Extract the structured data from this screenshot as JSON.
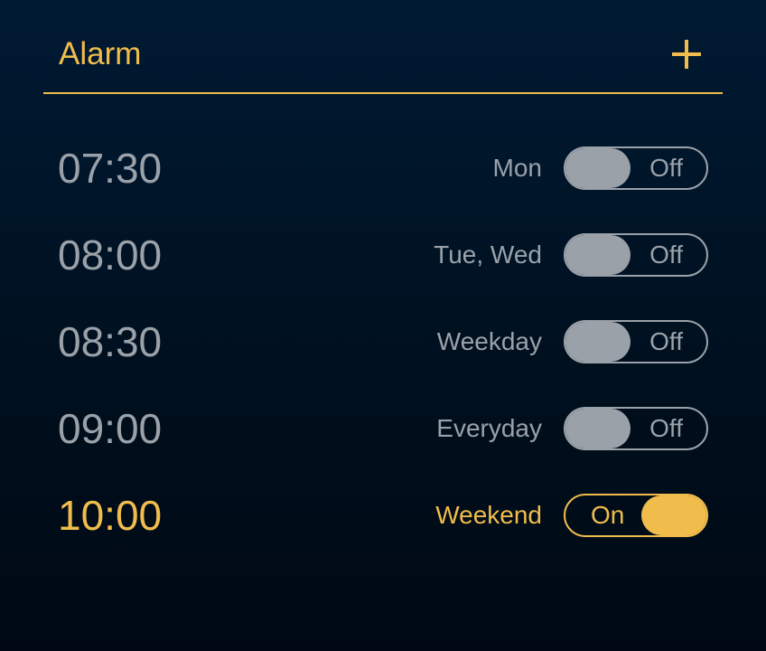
{
  "header": {
    "title": "Alarm",
    "add_icon": "plus-icon"
  },
  "colors": {
    "accent": "#f0bc4c",
    "inactive": "#9aa1a9",
    "background_top": "#001a33",
    "background_bottom": "#000913"
  },
  "alarms": [
    {
      "time": "07:30",
      "days": "Mon",
      "toggle_label": "Off",
      "enabled": false
    },
    {
      "time": "08:00",
      "days": "Tue, Wed",
      "toggle_label": "Off",
      "enabled": false
    },
    {
      "time": "08:30",
      "days": "Weekday",
      "toggle_label": "Off",
      "enabled": false
    },
    {
      "time": "09:00",
      "days": "Everyday",
      "toggle_label": "Off",
      "enabled": false
    },
    {
      "time": "10:00",
      "days": "Weekend",
      "toggle_label": "On",
      "enabled": true
    }
  ]
}
